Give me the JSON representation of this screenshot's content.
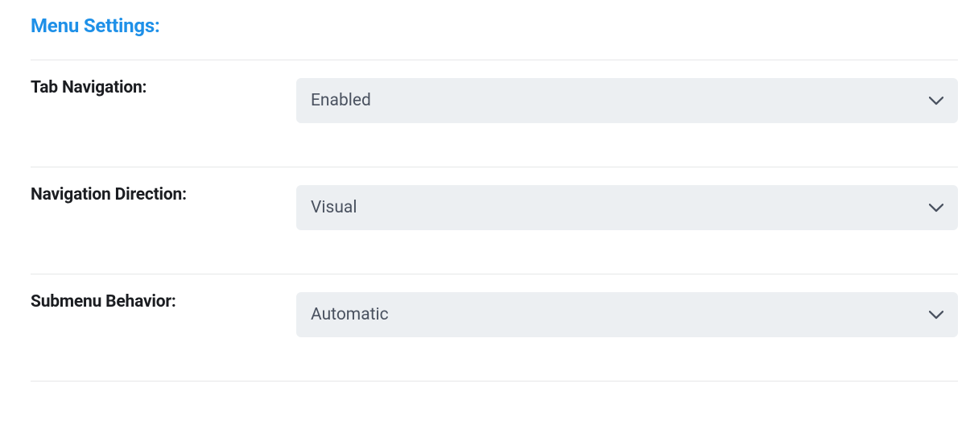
{
  "section": {
    "title": "Menu Settings:"
  },
  "settings": {
    "tabNavigation": {
      "label": "Tab Navigation:",
      "value": "Enabled"
    },
    "navigationDirection": {
      "label": "Navigation Direction:",
      "value": "Visual"
    },
    "submenuBehavior": {
      "label": "Submenu Behavior:",
      "value": "Automatic"
    }
  }
}
